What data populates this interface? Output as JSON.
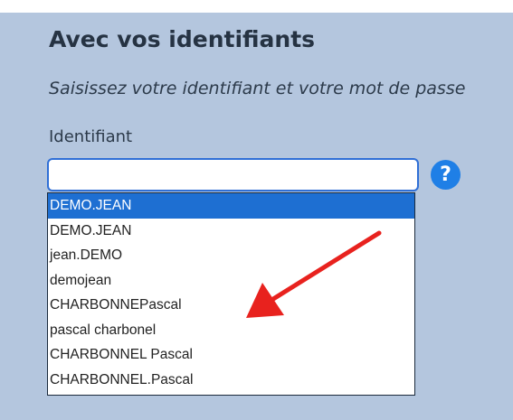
{
  "section": {
    "heading": "Avec vos identifiants",
    "subtitle": "Saisissez votre identifiant et votre mot de passe",
    "field_label": "Identifiant",
    "input_value": ""
  },
  "help_icon": {
    "glyph": "?"
  },
  "dropdown": {
    "options": [
      "DEMO.JEAN",
      "DEMO.JEAN",
      "jean.DEMO",
      "demojean",
      "CHARBONNEPascal",
      "pascal charbonel",
      "CHARBONNEL Pascal",
      "CHARBONNEL.Pascal"
    ],
    "selected_index": 0
  },
  "colors": {
    "panel_background": "#b4c6de",
    "input_border": "#2f6fd6",
    "selected_option": "#1e6fd2",
    "help_icon": "#1f7fe6",
    "annotation_arrow": "#e8221e"
  },
  "annotation": {
    "icon": "red-arrow-icon"
  }
}
